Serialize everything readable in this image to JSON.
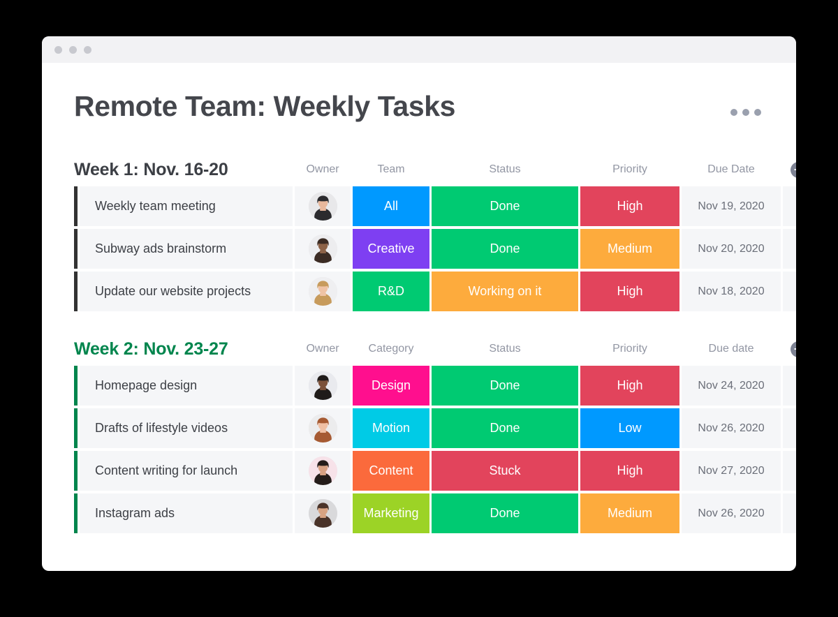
{
  "window": {
    "traffic_lights": [
      "dot-1",
      "dot-2",
      "dot-3"
    ],
    "menu_icon": "kebab-menu-icon"
  },
  "header": {
    "title": "Remote Team: Weekly Tasks",
    "more_menu_label": "•••"
  },
  "colors": {
    "green": "#00ca72",
    "red": "#e2445c",
    "orange": "#fdab3d",
    "blue": "#0099ff",
    "purple": "#7e3ff2",
    "magenta": "#ff0f8e",
    "cyan": "#00cbe6",
    "orange_deep": "#fb6a3c",
    "lime": "#9cd326",
    "group1_accent": "#333333",
    "group2_accent": "#00854d",
    "group2_title": "#00854d",
    "group1_title": "#3c3f45",
    "cell_bg": "#f5f6f8",
    "header_label": "#9296a3",
    "plus_button": "#7e8394"
  },
  "boards": [
    {
      "id": "week-1",
      "title": "Week 1: Nov. 16-20",
      "title_color": "#3c3f45",
      "accent_color": "#333333",
      "add_column_label": "+",
      "columns": [
        "Owner",
        "Team",
        "Status",
        "Priority",
        "Due Date"
      ],
      "rows": [
        {
          "task": "Weekly team meeting",
          "owner": "avatar-woman-dark-hair",
          "tag": "All",
          "tag_color": "#0099ff",
          "status": "Done",
          "status_color": "#00ca72",
          "priority": "High",
          "priority_color": "#e2445c",
          "due_date": "Nov 19, 2020"
        },
        {
          "task": "Subway ads brainstorm",
          "owner": "avatar-man-beard",
          "tag": "Creative",
          "tag_color": "#7e3ff2",
          "status": "Done",
          "status_color": "#00ca72",
          "priority": "Medium",
          "priority_color": "#fdab3d",
          "due_date": "Nov 20, 2020"
        },
        {
          "task": "Update our website projects",
          "owner": "avatar-woman-blonde",
          "tag": "R&D",
          "tag_color": "#00ca72",
          "status": "Working on it",
          "status_color": "#fdab3d",
          "priority": "High",
          "priority_color": "#e2445c",
          "due_date": "Nov 18, 2020"
        }
      ]
    },
    {
      "id": "week-2",
      "title": "Week 2: Nov. 23-27",
      "title_color": "#00854d",
      "accent_color": "#00854d",
      "add_column_label": "+",
      "columns": [
        "Owner",
        "Category",
        "Status",
        "Priority",
        "Due date"
      ],
      "rows": [
        {
          "task": "Homepage design",
          "owner": "avatar-woman-glasses",
          "tag": "Design",
          "tag_color": "#ff0f8e",
          "status": "Done",
          "status_color": "#00ca72",
          "priority": "High",
          "priority_color": "#e2445c",
          "due_date": "Nov 24, 2020"
        },
        {
          "task": "Drafts of lifestyle videos",
          "owner": "avatar-woman-curly",
          "tag": "Motion",
          "tag_color": "#00cbe6",
          "status": "Done",
          "status_color": "#00ca72",
          "priority": "Low",
          "priority_color": "#0099ff",
          "due_date": "Nov 26, 2020"
        },
        {
          "task": "Content writing for launch",
          "owner": "avatar-woman-dark-jacket",
          "tag": "Content",
          "tag_color": "#fb6a3c",
          "status": "Stuck",
          "status_color": "#e2445c",
          "priority": "High",
          "priority_color": "#e2445c",
          "due_date": "Nov 27, 2020"
        },
        {
          "task": "Instagram ads",
          "owner": "avatar-man-floral",
          "tag": "Marketing",
          "tag_color": "#9cd326",
          "status": "Done",
          "status_color": "#00ca72",
          "priority": "Medium",
          "priority_color": "#fdab3d",
          "due_date": "Nov 26, 2020"
        }
      ]
    }
  ]
}
